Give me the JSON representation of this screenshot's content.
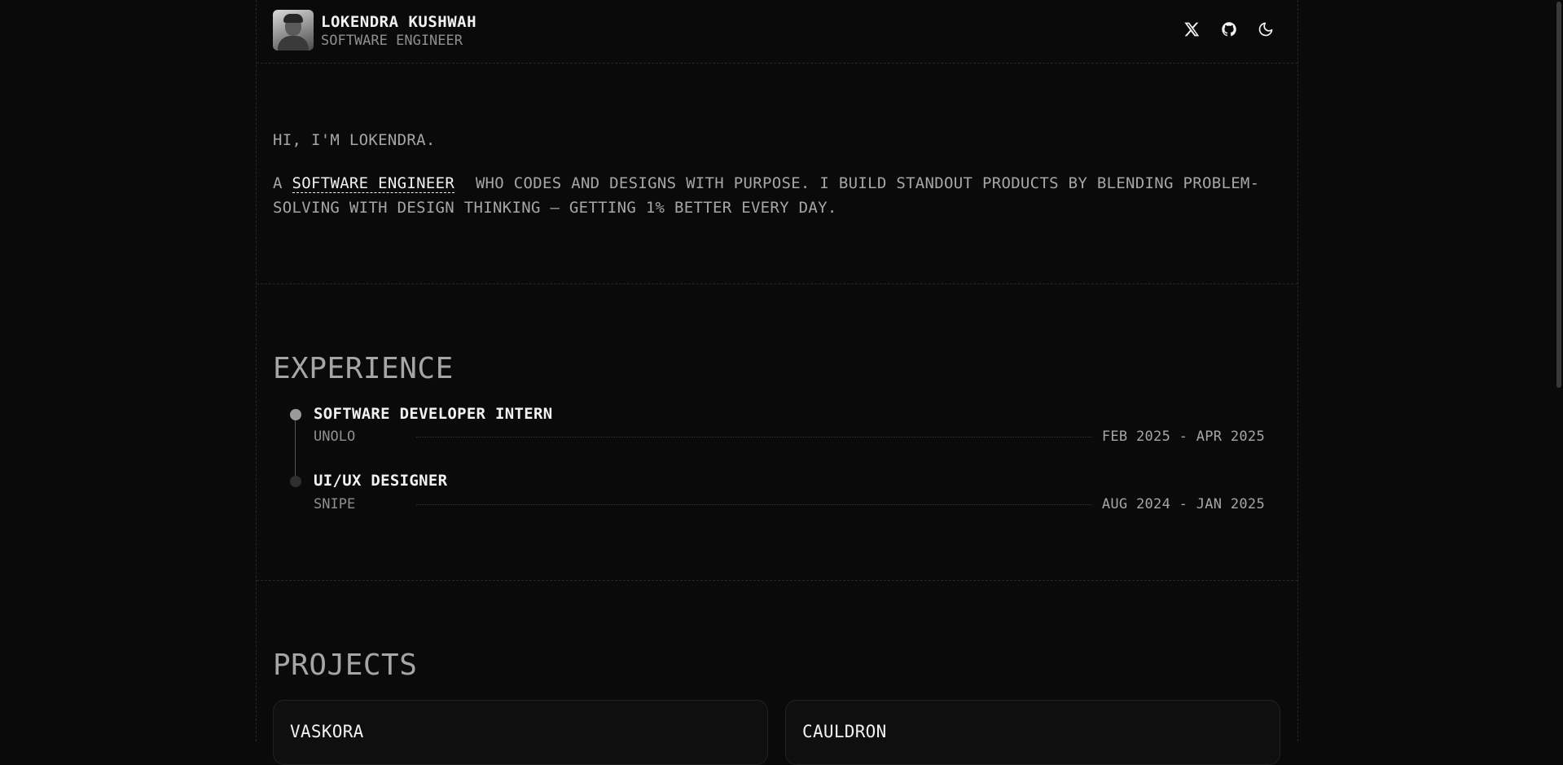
{
  "header": {
    "name": "LOKENDRA KUSHWAH",
    "role": "SOFTWARE ENGINEER",
    "icons": [
      "x-icon",
      "github-icon",
      "moon-icon"
    ]
  },
  "hero": {
    "greeting": "HI, I'M LOKENDRA.",
    "intro_prefix": "A",
    "intro_link": "SOFTWARE ENGINEER",
    "intro_rest": "WHO CODES AND DESIGNS WITH PURPOSE. I BUILD STANDOUT PRODUCTS BY BLENDING PROBLEM-SOLVING WITH DESIGN THINKING — GETTING 1% BETTER EVERY DAY."
  },
  "experience": {
    "title": "EXPERIENCE",
    "items": [
      {
        "title": "SOFTWARE DEVELOPER INTERN",
        "company": "UNOLO",
        "dates": "FEB 2025 - APR 2025",
        "active": true
      },
      {
        "title": "UI/UX DESIGNER",
        "company": "SNIPE",
        "dates": "AUG 2024 - JAN 2025",
        "active": false
      }
    ]
  },
  "projects": {
    "title": "PROJECTS",
    "items": [
      {
        "title": "VASKORA"
      },
      {
        "title": "CAULDRON"
      }
    ]
  },
  "colors": {
    "background": "#0a0a0a",
    "text_primary": "#f2f2f2",
    "text_secondary": "#a6a6a6",
    "dot_active": "#9a9a9a",
    "dot_inactive": "#2e2e2e"
  }
}
